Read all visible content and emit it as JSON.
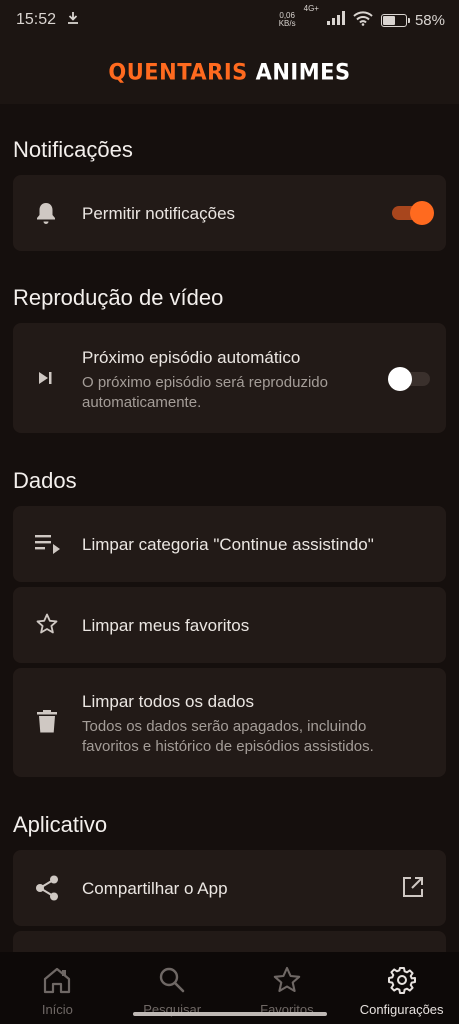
{
  "status_bar": {
    "time": "15:52",
    "net_speed": "0,06\nKB/s",
    "net_type": "4G+",
    "battery_pct": "58%",
    "battery_level": 0.58
  },
  "app": {
    "logo_part1": "QUENTARIS",
    "logo_part2": "ANIMES",
    "accent_color": "#ff6a1f"
  },
  "sections": {
    "notifications": {
      "title": "Notificações",
      "allow_label": "Permitir notificações",
      "allow_enabled": true
    },
    "playback": {
      "title": "Reprodução de vídeo",
      "autoplay_label": "Próximo episódio automático",
      "autoplay_desc": "O próximo episódio será reproduzido automaticamente.",
      "autoplay_enabled": false
    },
    "data": {
      "title": "Dados",
      "clear_continue": "Limpar categoria \"Continue assistindo\"",
      "clear_favorites": "Limpar meus favoritos",
      "clear_all": "Limpar todos os dados",
      "clear_all_desc": "Todos os dados serão apagados, incluindo favoritos e histórico de episódios assistidos."
    },
    "app": {
      "title": "Aplicativo",
      "share_label": "Compartilhar o App"
    }
  },
  "bottom_nav": {
    "items": [
      {
        "label": "Início",
        "icon": "home-icon",
        "active": false
      },
      {
        "label": "Pesquisar",
        "icon": "search-icon",
        "active": false
      },
      {
        "label": "Favoritos",
        "icon": "star-icon",
        "active": false
      },
      {
        "label": "Configurações",
        "icon": "gear-icon",
        "active": true
      }
    ]
  }
}
